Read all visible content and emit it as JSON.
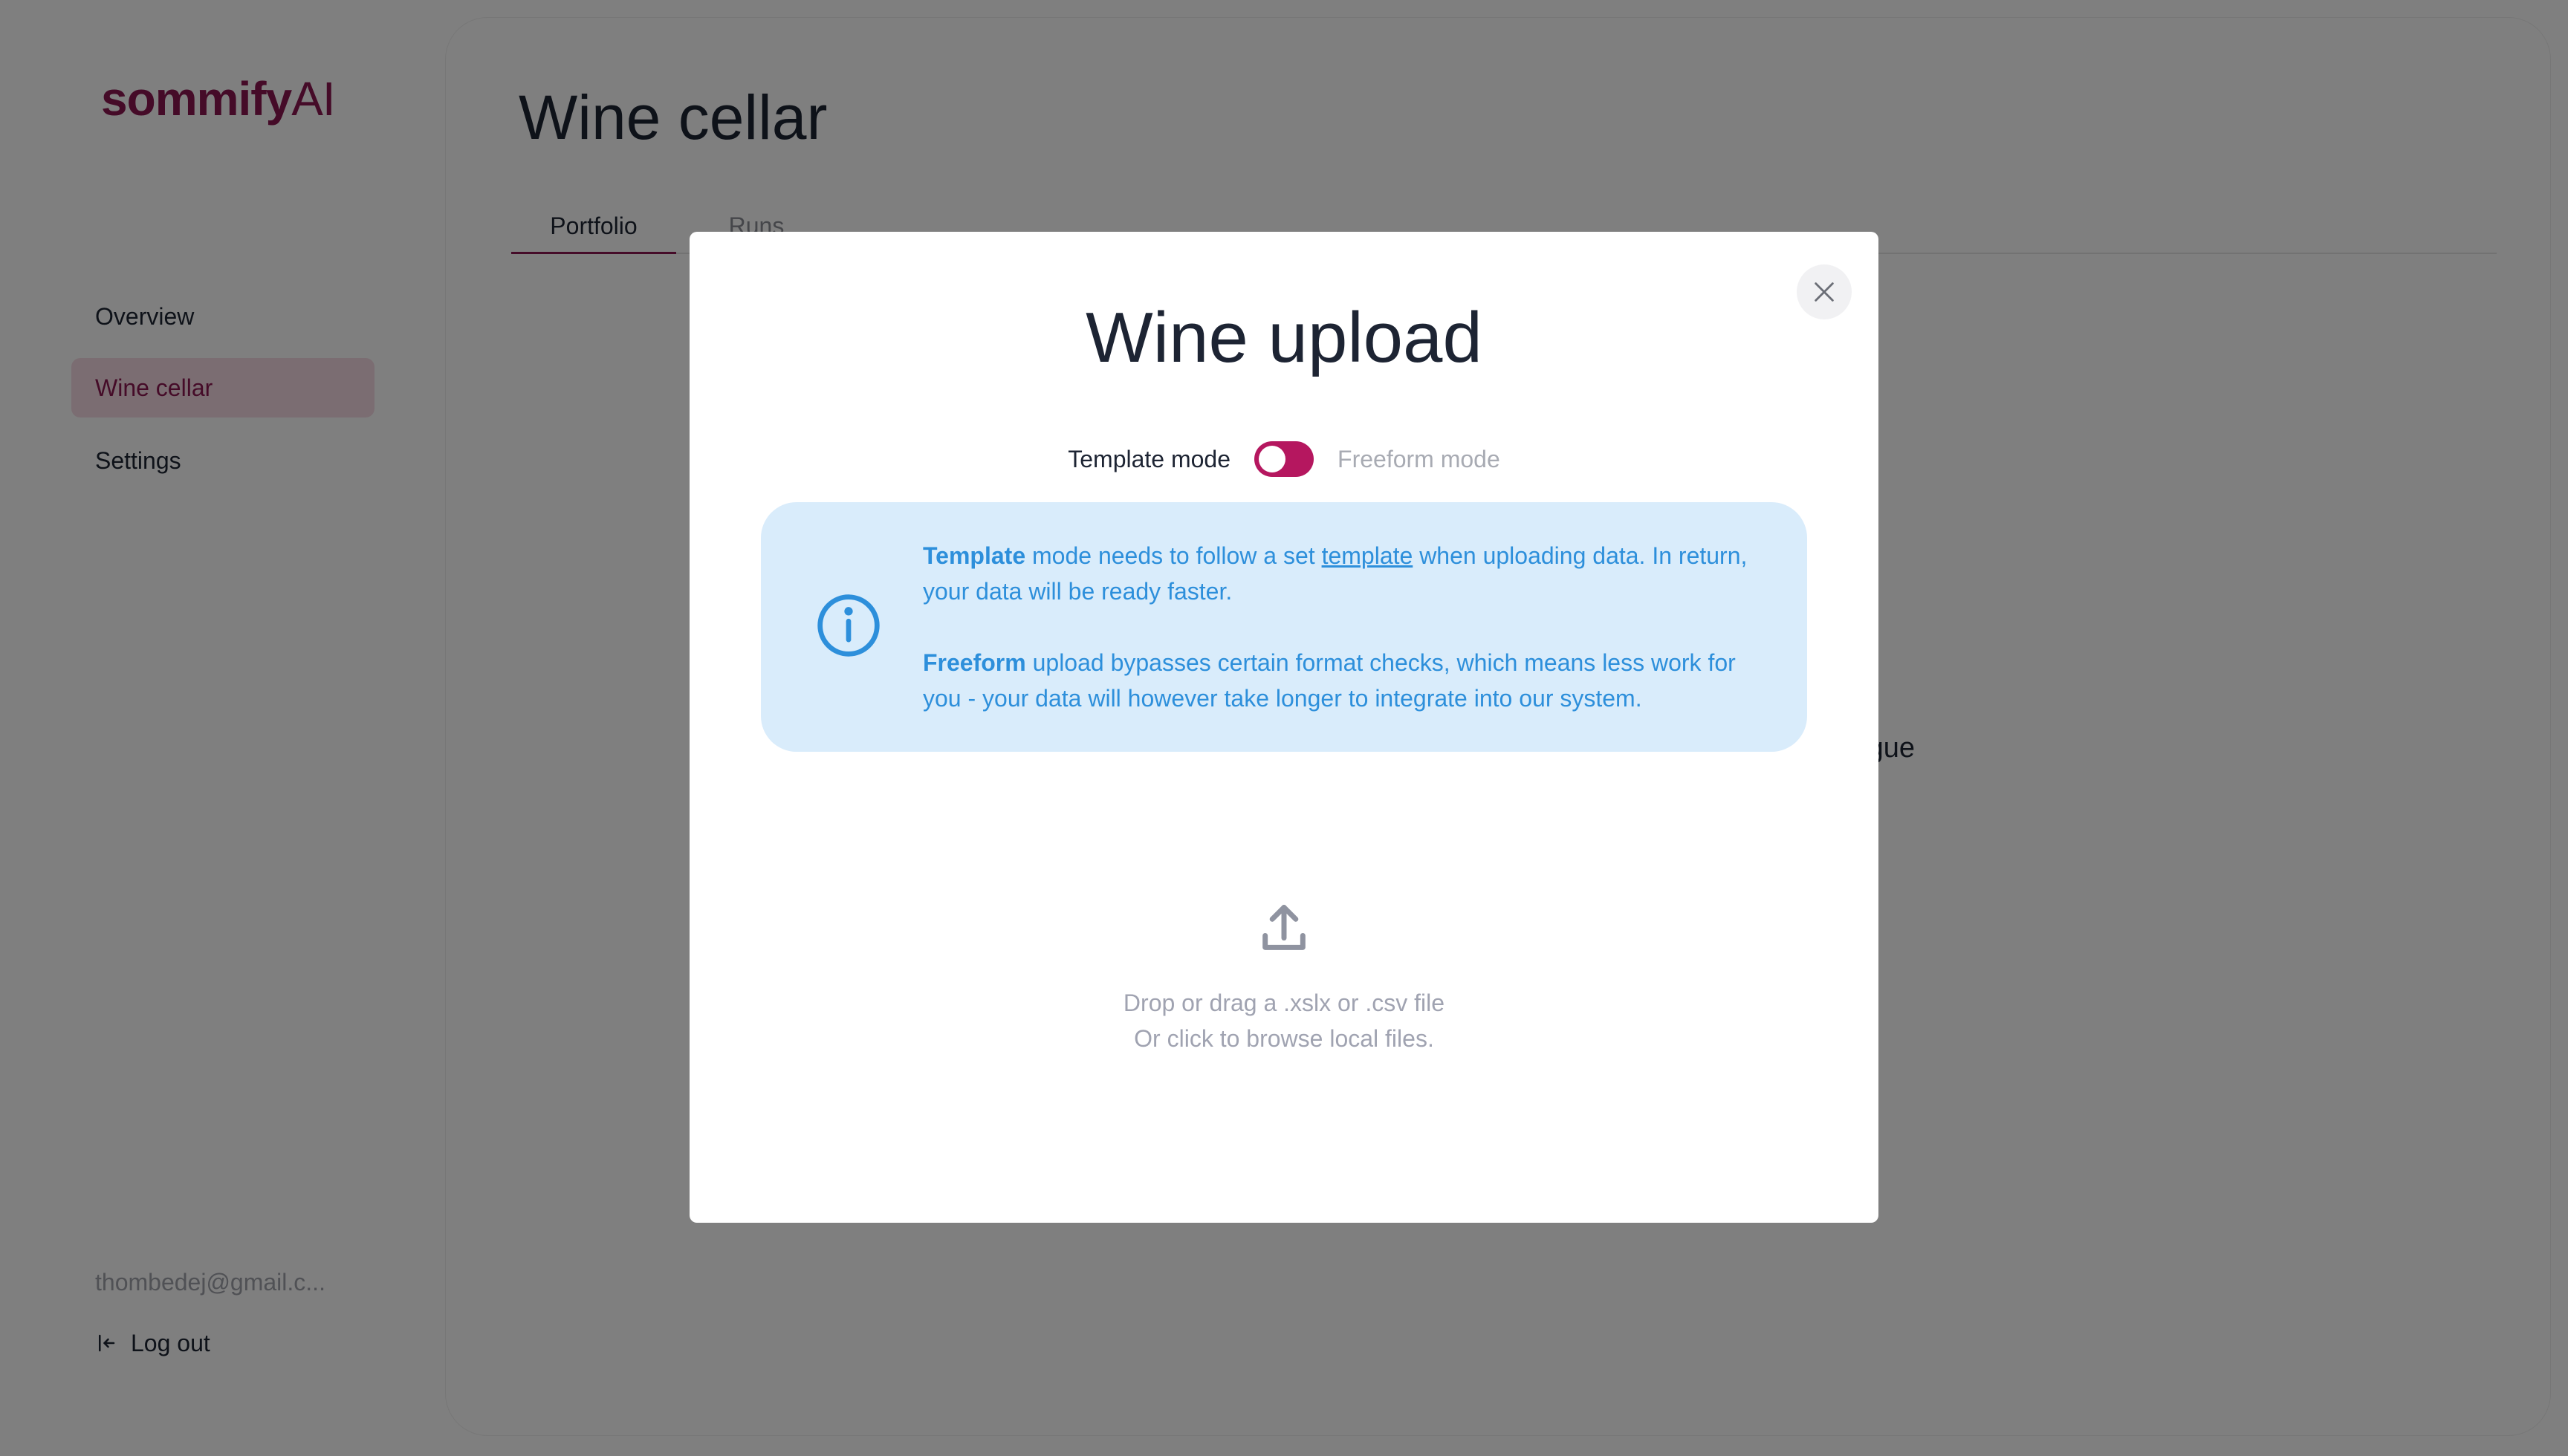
{
  "brand": {
    "name_main": "sommify",
    "name_suffix": "AI",
    "accent": "#8a1650"
  },
  "sidebar": {
    "items": [
      {
        "label": "Overview",
        "active": false
      },
      {
        "label": "Wine cellar",
        "active": true
      },
      {
        "label": "Settings",
        "active": false
      }
    ],
    "user_email": "thombedej@gmail.c...",
    "logout_label": "Log out"
  },
  "main": {
    "title": "Wine cellar",
    "tabs": [
      {
        "label": "Portfolio",
        "active": true
      },
      {
        "label": "Runs",
        "active": false
      }
    ],
    "behind_text_fragment": "logue"
  },
  "modal": {
    "title": "Wine upload",
    "close_icon": "close-icon",
    "mode_toggle": {
      "left_label": "Template mode",
      "right_label": "Freeform mode",
      "selected": "Template mode",
      "color": "#b5175f"
    },
    "info": {
      "icon": "info-icon",
      "color": "#2d8fdb",
      "background": "#d9ecfb",
      "template_bold": "Template",
      "template_text_1": " mode needs to follow a set ",
      "template_link": "template",
      "template_text_2": " when uploading data. In return, your data will be ready faster.",
      "freeform_bold": "Freeform",
      "freeform_text": " upload bypasses certain format checks, which means less work for you - your data will however take longer to integrate into our system."
    },
    "dropzone": {
      "icon": "upload-icon",
      "line1": "Drop or drag a .xslx or .csv file",
      "line2": "Or click to browse local files."
    }
  }
}
